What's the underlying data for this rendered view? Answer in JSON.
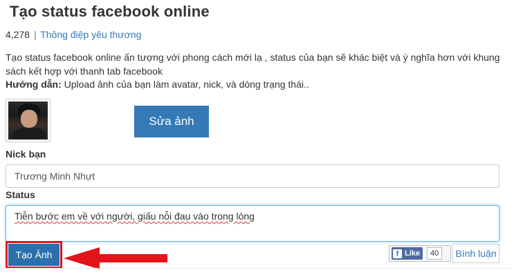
{
  "page": {
    "title": "Tạo status facebook online",
    "views": "4,278",
    "separator": "|",
    "category_link": "Thông điệp yêu thương",
    "description": "Tạo status facebook online ấn tượng với phong cách mới lạ , status của bạn sẽ khác biệt và ý nghĩa hơn với khung sách kết hợp với thanh tab facebook",
    "guide_label": "Hướng dẫn:",
    "guide_text": " Upload ảnh của bạn làm avatar, nick, và dòng trạng thái.."
  },
  "form": {
    "edit_photo_label": "Sửa ảnh",
    "nick_label": "Nick bạn",
    "nick_value": "Trương Minh Nhựt",
    "status_label": "Status",
    "status_value": "Tiễn bước em về với người, giấu nỗi đau vào trong lòng",
    "create_label": "Tạo Ảnh"
  },
  "social": {
    "like_label": "Like",
    "like_count": "40",
    "comment_label": "Bình luận"
  },
  "colors": {
    "primary": "#337ab7",
    "highlight": "#e3131b",
    "facebook": "#4e69a2"
  }
}
